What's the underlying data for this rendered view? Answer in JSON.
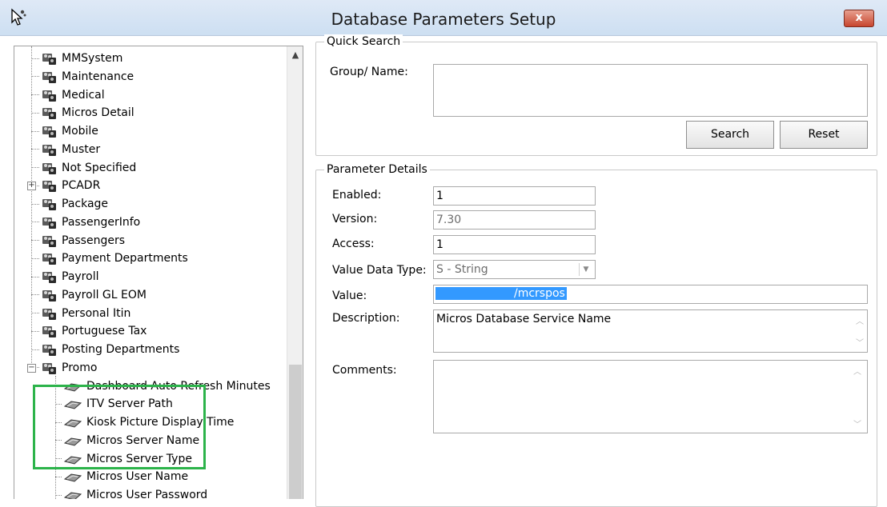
{
  "window": {
    "title": "Database Parameters Setup",
    "close_label": "x"
  },
  "tree": {
    "groups": [
      {
        "label": "MMSystem"
      },
      {
        "label": "Maintenance"
      },
      {
        "label": "Medical"
      },
      {
        "label": "Micros Detail"
      },
      {
        "label": "Mobile"
      },
      {
        "label": "Muster"
      },
      {
        "label": "Not Specified"
      },
      {
        "label": "PCADR"
      },
      {
        "label": "Package"
      },
      {
        "label": "PassengerInfo"
      },
      {
        "label": "Passengers"
      },
      {
        "label": "Payment Departments"
      },
      {
        "label": "Payroll"
      },
      {
        "label": "Payroll GL EOM"
      },
      {
        "label": "Personal Itin"
      },
      {
        "label": "Portuguese Tax"
      },
      {
        "label": "Posting Departments"
      },
      {
        "label": "Promo"
      }
    ],
    "promo_children": [
      {
        "label": "Dashboard Auto Refresh Minutes"
      },
      {
        "label": "ITV Server Path"
      },
      {
        "label": "Kiosk Picture Display Time"
      },
      {
        "label": "Micros Server Name"
      },
      {
        "label": "Micros Server Type"
      },
      {
        "label": "Micros User Name"
      },
      {
        "label": "Micros User Password"
      }
    ],
    "expanders": {
      "collapsed": "+",
      "expanded": "−"
    },
    "scroll_up_arrow": "▲",
    "highlight_color": "#2cb34a"
  },
  "quick_search": {
    "legend": "Quick Search",
    "group_name_label": "Group/ Name:",
    "group_name_value": "",
    "search_button": "Search",
    "reset_button": "Reset"
  },
  "parameter_details": {
    "legend": "Parameter Details",
    "enabled_label": "Enabled:",
    "enabled_value": "1",
    "version_label": "Version:",
    "version_value": "7.30",
    "access_label": "Access:",
    "access_value": "1",
    "value_data_type_label": "Value Data Type:",
    "value_data_type_value": "S - String",
    "value_label": "Value:",
    "value_value": "/mcrspos",
    "description_label": "Description:",
    "description_value": "Micros Database Service Name",
    "comments_label": "Comments:",
    "comments_value": ""
  },
  "colors": {
    "accent_selection": "#3399ff",
    "close_button": "#c7462f"
  }
}
